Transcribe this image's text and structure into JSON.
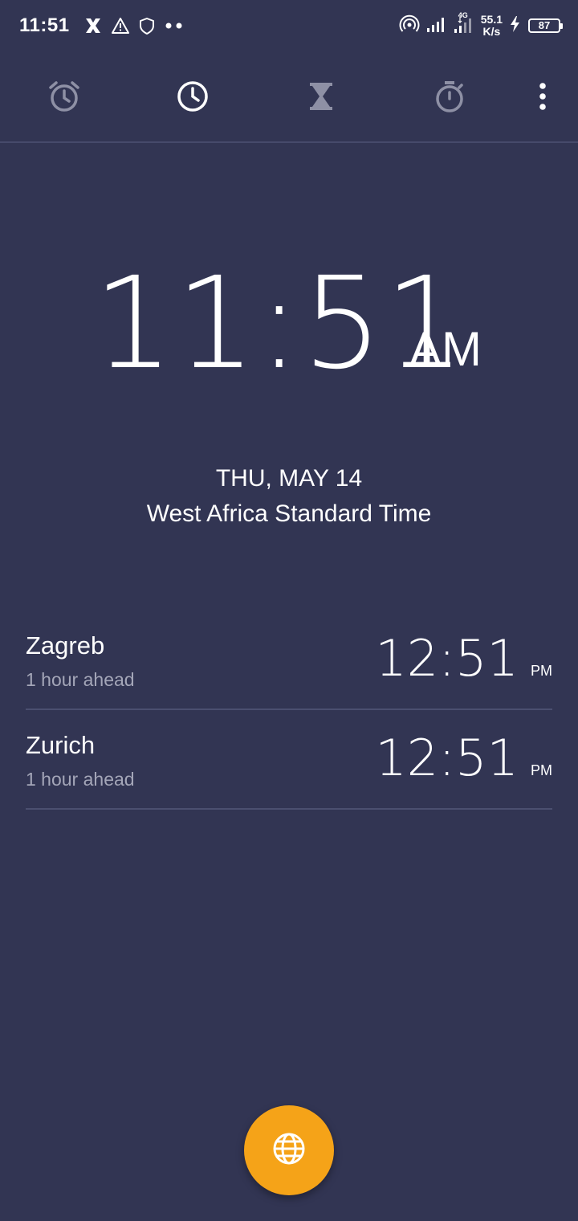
{
  "status_bar": {
    "time": "11:51",
    "network_type": "4G",
    "speed_value": "55.1",
    "speed_unit": "K/s",
    "battery": "87",
    "icons": [
      "x-app-icon",
      "warning-icon",
      "shield-icon",
      "more-notifications-icon",
      "hotspot-icon",
      "signal-icon",
      "signal-4g-icon",
      "charging-icon",
      "battery-icon"
    ]
  },
  "tabs": [
    {
      "name": "alarm",
      "icon": "alarm-icon",
      "active": false
    },
    {
      "name": "clock",
      "icon": "clock-icon",
      "active": true
    },
    {
      "name": "timer",
      "icon": "hourglass-icon",
      "active": false
    },
    {
      "name": "stopwatch",
      "icon": "stopwatch-icon",
      "active": false
    }
  ],
  "menu_icon": "more-vert-icon",
  "main_clock": {
    "time": "11:51",
    "ampm": "AM",
    "date": "THU, MAY 14",
    "timezone": "West Africa Standard Time"
  },
  "cities": [
    {
      "name": "Zagreb",
      "offset": "1 hour ahead",
      "time": "12:51",
      "ampm": "PM"
    },
    {
      "name": "Zurich",
      "offset": "1 hour ahead",
      "time": "12:51",
      "ampm": "PM"
    }
  ],
  "fab": {
    "icon": "globe-icon"
  },
  "colors": {
    "background": "#323553",
    "accent": "#f5a318",
    "inactive_icon": "#8e90a5",
    "secondary_text": "#a4a6b8",
    "divider": "#4b4f6f"
  }
}
